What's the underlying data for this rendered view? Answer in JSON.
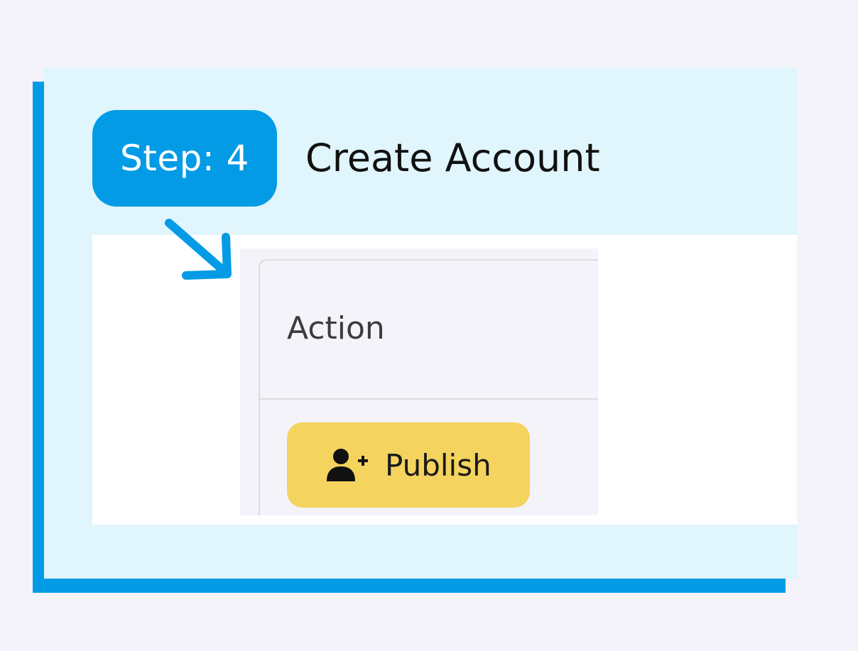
{
  "step": {
    "badge_label": "Step: 4",
    "title": "Create Account"
  },
  "snippet": {
    "column_header": "Action",
    "publish_button": {
      "label": "Publish",
      "icon": "user-plus-icon"
    }
  },
  "colors": {
    "accent": "#039be5",
    "card_background": "#e0f5fc",
    "page_background": "#f5f3fa",
    "button_yellow": "#f4d35e"
  }
}
